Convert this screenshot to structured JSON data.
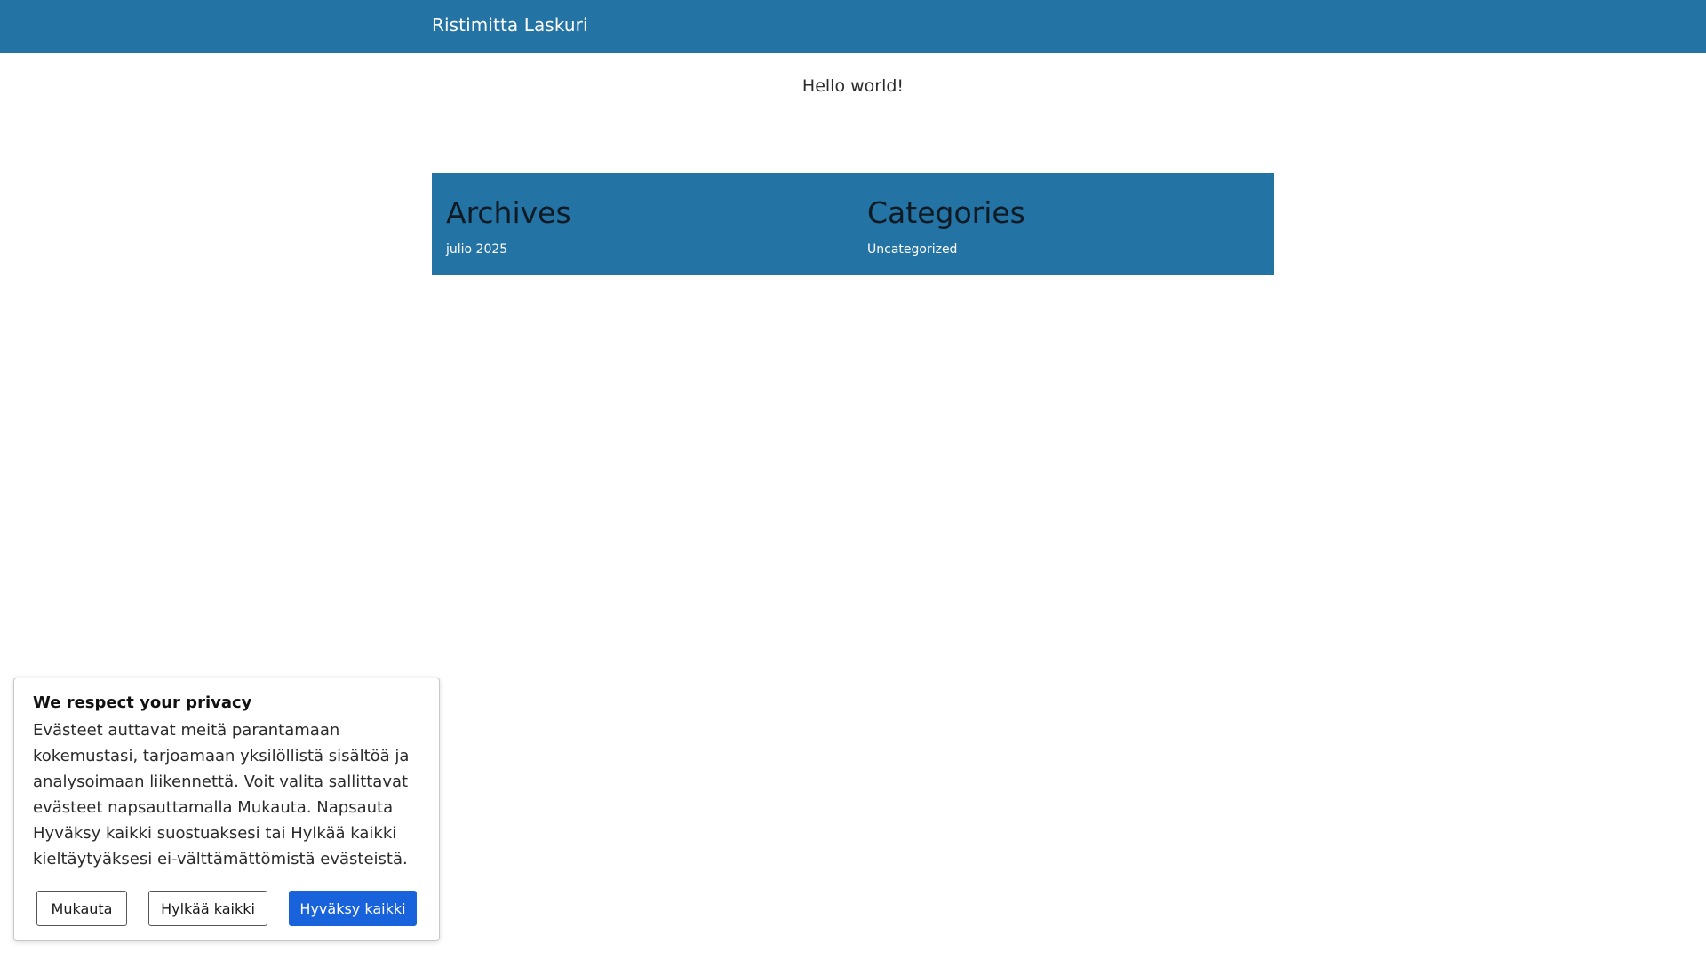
{
  "header": {
    "site_title": "Ristimitta Laskuri"
  },
  "main": {
    "post_title": "Hello world!"
  },
  "widgets": {
    "archives": {
      "title": "Archives",
      "link": "julio 2025"
    },
    "categories": {
      "title": "Categories",
      "link": "Uncategorized"
    }
  },
  "cookie_banner": {
    "title": "We respect your privacy",
    "text": "Evästeet auttavat meitä parantamaan kokemustasi, tarjoamaan yksilöllistä sisältöä ja analysoimaan liikennettä. Voit valita sallittavat evästeet napsauttamalla Mukauta. Napsauta Hyväksy kaikki suostuaksesi tai Hylkää kaikki kieltäytyäksesi ei-välttämättömistä evästeistä.",
    "customize_label": "Mukauta",
    "reject_label": "Hylkää kaikki",
    "accept_label": "Hyväksy kaikki"
  },
  "colors": {
    "brand": "#2473a5",
    "accept_button": "#1863dc"
  }
}
